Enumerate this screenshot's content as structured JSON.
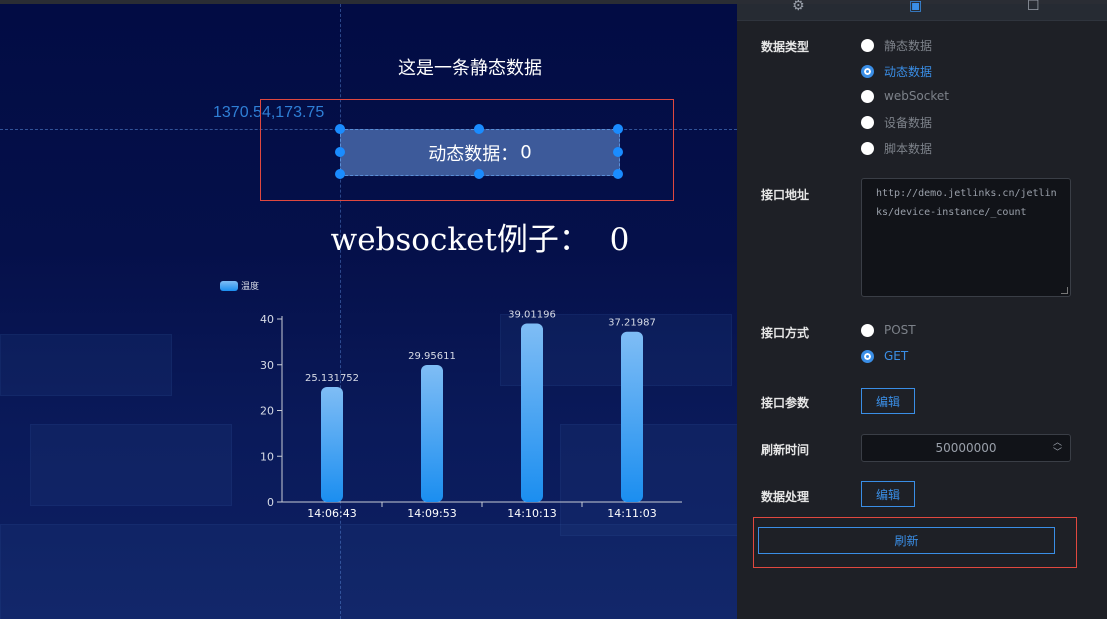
{
  "canvas": {
    "coord_readout": "1370.54,173.75",
    "static_text": "这是一条静态数据",
    "dynamic_label": "动态数据：",
    "dynamic_value": "0",
    "websocket_text": "websocket例子：  0"
  },
  "chart_data": {
    "type": "bar",
    "categories": [
      "14:06:43",
      "14:09:53",
      "14:10:13",
      "14:11:03"
    ],
    "series": [
      {
        "name": "温度",
        "values": [
          25.131752,
          29.95611,
          39.01196,
          37.21987
        ]
      }
    ],
    "data_labels": [
      "25.131752",
      "29.95611",
      "39.01196",
      "37.21987"
    ],
    "yticks": [
      "0",
      "10",
      "20",
      "30",
      "40"
    ],
    "ylim": [
      0,
      40
    ],
    "legend_position": "top-left",
    "colors": {
      "bar_top": "#7fbdf5",
      "bar_bottom": "#1b8ef0",
      "axis": "#c8ccd6",
      "text": "#d7dbe6"
    }
  },
  "sidebar": {
    "tabs": [
      {
        "icon": "gear-icon"
      },
      {
        "icon": "data-icon"
      },
      {
        "icon": "square-icon"
      }
    ],
    "data_type": {
      "label": "数据类型",
      "options": [
        "静态数据",
        "动态数据",
        "webSocket",
        "设备数据",
        "脚本数据"
      ],
      "selected": "动态数据"
    },
    "api_url": {
      "label": "接口地址",
      "value": "http://demo.jetlinks.cn/jetlinks/device-instance/_count"
    },
    "api_method": {
      "label": "接口方式",
      "options": [
        "POST",
        "GET"
      ],
      "selected": "GET"
    },
    "api_params": {
      "label": "接口参数",
      "button": "编辑"
    },
    "refresh_interval": {
      "label": "刷新时间",
      "value": "50000000"
    },
    "data_processing": {
      "label": "数据处理",
      "button": "编辑"
    },
    "refresh_button": "刷新",
    "colors": {
      "accent": "#3a8ee6",
      "highlight_border": "#e0483f"
    }
  }
}
